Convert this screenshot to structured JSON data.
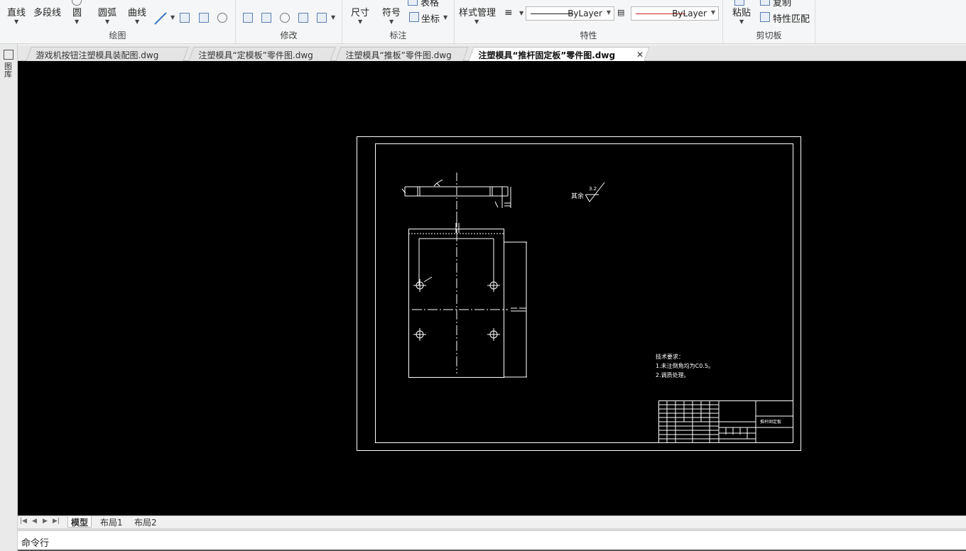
{
  "ribbon": {
    "draw": {
      "label": "绘图",
      "line": "直线",
      "polyline": "多段线",
      "circle": "圆",
      "arc": "圆弧",
      "curve": "曲线"
    },
    "modify": {
      "label": "修改"
    },
    "annotate": {
      "label": "标注",
      "dimension": "尺寸",
      "symbol": "符号",
      "table": "表格",
      "coordinate": "坐标"
    },
    "properties": {
      "label": "特性",
      "style_manager": "样式管理",
      "linetype_value": "ByLayer",
      "color_value": "ByLayer"
    },
    "clipboard": {
      "label": "剪切板",
      "paste": "粘贴",
      "copy": "复制",
      "match_props": "特性匹配"
    }
  },
  "dock": {
    "label": "图库"
  },
  "tabs": [
    {
      "label": "游戏机按钮注塑模具装配图.dwg",
      "active": false
    },
    {
      "label": "注塑模具“定模板”零件图.dwg",
      "active": false
    },
    {
      "label": "注塑模具“推板”零件图.dwg",
      "active": false
    },
    {
      "label": "注塑模具“推杆固定板”零件图.dwg",
      "active": true
    }
  ],
  "drawing": {
    "roughness_label": "其余",
    "roughness_value": "3.2",
    "tech_req": [
      "技术要求：",
      "1.未注倒角均为C0.5。",
      "2.调质处理。"
    ],
    "title_block_name": "推杆固定板"
  },
  "layouts": [
    {
      "label": "模型",
      "active": true
    },
    {
      "label": "布局1",
      "active": false
    },
    {
      "label": "布局2",
      "active": false
    }
  ],
  "command": {
    "label": "命令行"
  },
  "colors": {
    "canvas": "#000000",
    "line_red": "#d22020"
  }
}
